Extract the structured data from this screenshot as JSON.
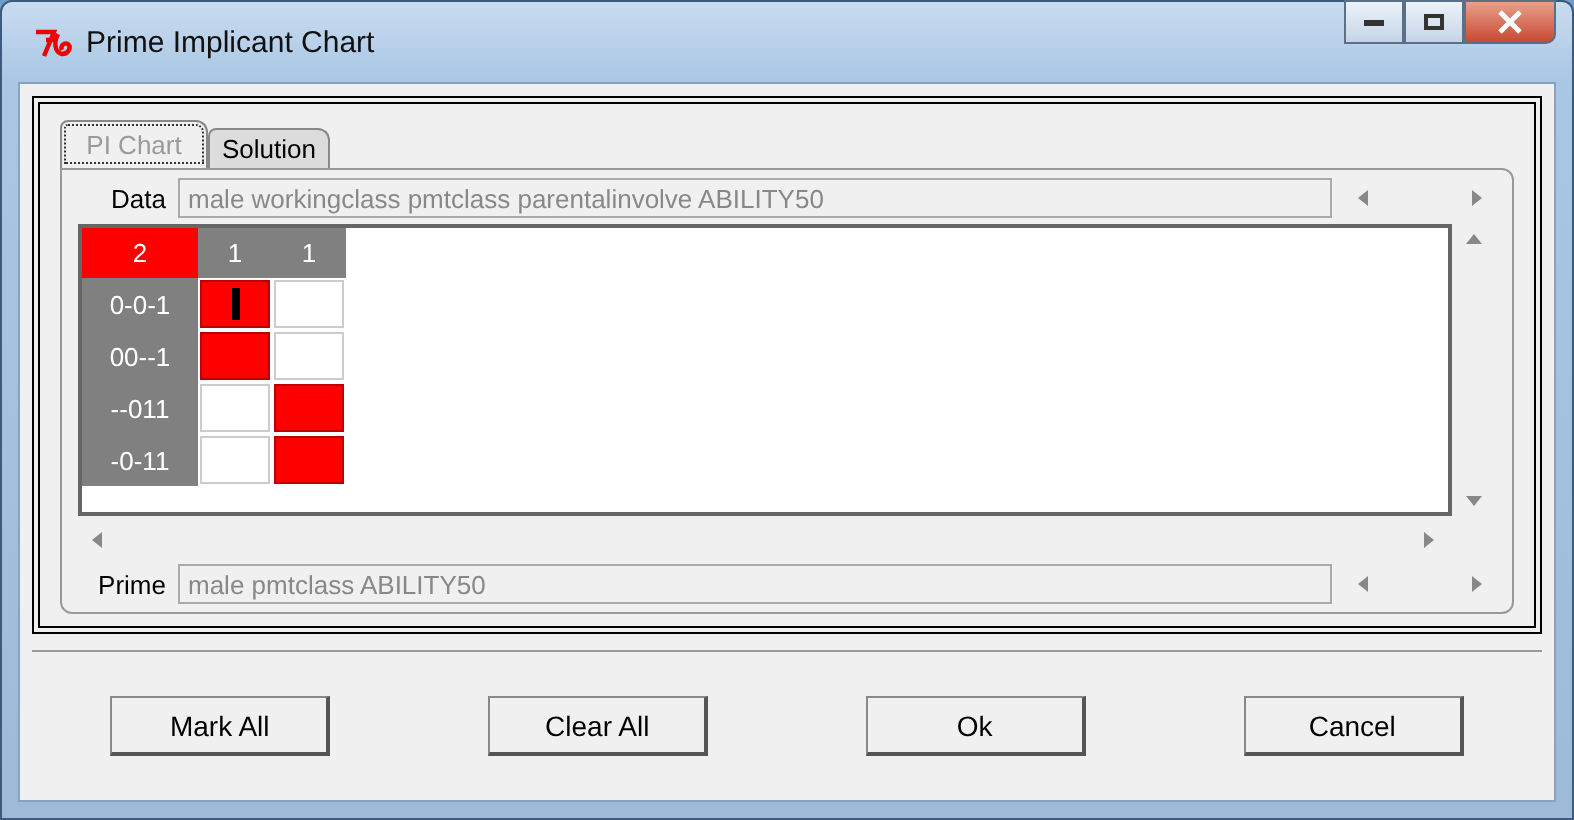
{
  "window": {
    "title": "Prime Implicant Chart"
  },
  "tabs": [
    {
      "label": "PI Chart",
      "selected": true
    },
    {
      "label": "Solution",
      "selected": false
    }
  ],
  "data_field": {
    "label": "Data",
    "value": "male workingclass pmtclass parentalinvolve ABILITY50"
  },
  "chart": {
    "columns": [
      {
        "label": "2",
        "highlighted": true
      },
      {
        "label": "1",
        "highlighted": false
      },
      {
        "label": "1",
        "highlighted": false
      }
    ],
    "rows": [
      {
        "label": "0-0-1",
        "cells": [
          {
            "marked": true,
            "cursor": true
          },
          {
            "marked": false,
            "cursor": false
          }
        ]
      },
      {
        "label": "00--1",
        "cells": [
          {
            "marked": true,
            "cursor": false
          },
          {
            "marked": false,
            "cursor": false
          }
        ]
      },
      {
        "label": "--011",
        "cells": [
          {
            "marked": false,
            "cursor": false
          },
          {
            "marked": true,
            "cursor": false
          }
        ]
      },
      {
        "label": "-0-11",
        "cells": [
          {
            "marked": false,
            "cursor": false
          },
          {
            "marked": true,
            "cursor": false
          }
        ]
      }
    ]
  },
  "prime_field": {
    "label": "Prime",
    "value": "male pmtclass ABILITY50"
  },
  "buttons": [
    "Mark All",
    "Clear All",
    "Ok",
    "Cancel"
  ]
}
